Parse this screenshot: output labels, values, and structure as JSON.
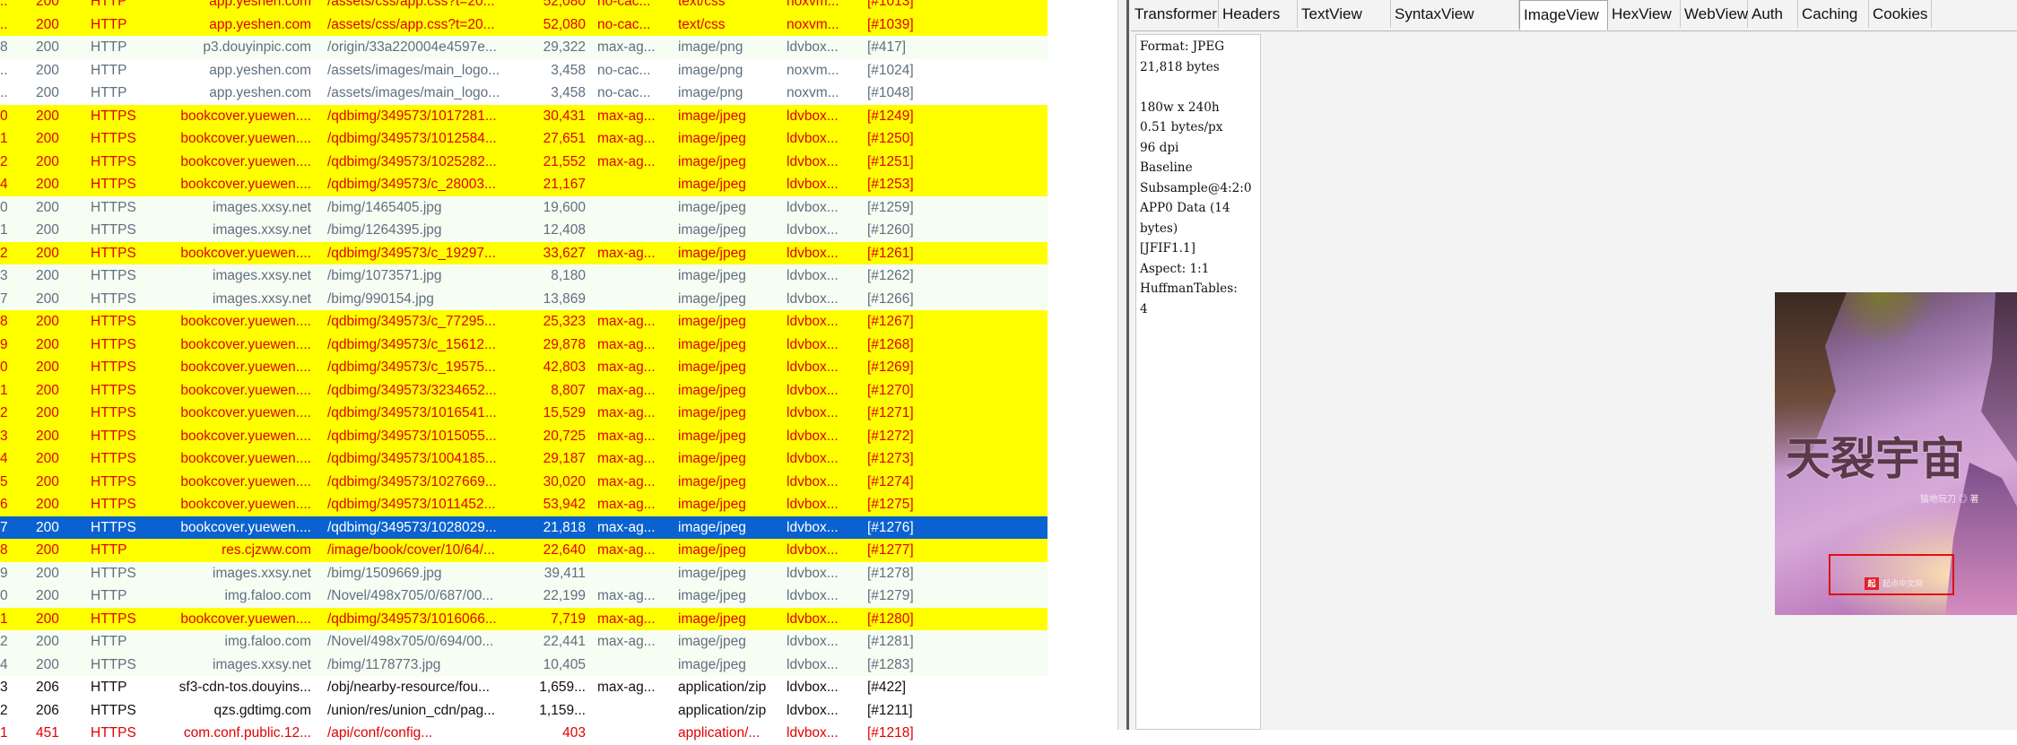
{
  "colors": {
    "highlight_yellow": "#ffff00",
    "selected_blue": "#0a62d0",
    "row_green": "#f6fdf3",
    "red_text": "#e00000"
  },
  "grid": {
    "rows": [
      {
        "id": "..",
        "result": "200",
        "protocol": "HTTP",
        "host": "app.yeshen.com",
        "url": "/assets/css/app.css?t=20...",
        "body": "52,080",
        "caching": "no-cac...",
        "content_type": "text/css",
        "process": "noxvm...",
        "custom": "[#1013]",
        "style": "yellow red-text"
      },
      {
        "id": "..",
        "result": "200",
        "protocol": "HTTP",
        "host": "app.yeshen.com",
        "url": "/assets/css/app.css?t=20...",
        "body": "52,080",
        "caching": "no-cac...",
        "content_type": "text/css",
        "process": "noxvm...",
        "custom": "[#1039]",
        "style": "yellow red-text"
      },
      {
        "id": "8",
        "result": "200",
        "protocol": "HTTP",
        "host": "p3.douyinpic.com",
        "url": "/origin/33a220004e4597e...",
        "body": "29,322",
        "caching": "max-ag...",
        "content_type": "image/png",
        "process": "ldvbox...",
        "custom": "[#417]",
        "style": "gray-text"
      },
      {
        "id": "..",
        "result": "200",
        "protocol": "HTTP",
        "host": "app.yeshen.com",
        "url": "/assets/images/main_logo...",
        "body": "3,458",
        "caching": "no-cac...",
        "content_type": "image/png",
        "process": "noxvm...",
        "custom": "[#1024]",
        "style": "white gray-text"
      },
      {
        "id": "..",
        "result": "200",
        "protocol": "HTTP",
        "host": "app.yeshen.com",
        "url": "/assets/images/main_logo...",
        "body": "3,458",
        "caching": "no-cac...",
        "content_type": "image/png",
        "process": "noxvm...",
        "custom": "[#1048]",
        "style": "white gray-text"
      },
      {
        "id": "0",
        "result": "200",
        "protocol": "HTTPS",
        "host": "bookcover.yuewen....",
        "url": "/qdbimg/349573/1017281...",
        "body": "30,431",
        "caching": "max-ag...",
        "content_type": "image/jpeg",
        "process": "ldvbox...",
        "custom": "[#1249]",
        "style": "yellow red-text"
      },
      {
        "id": "1",
        "result": "200",
        "protocol": "HTTPS",
        "host": "bookcover.yuewen....",
        "url": "/qdbimg/349573/1012584...",
        "body": "27,651",
        "caching": "max-ag...",
        "content_type": "image/jpeg",
        "process": "ldvbox...",
        "custom": "[#1250]",
        "style": "yellow red-text"
      },
      {
        "id": "2",
        "result": "200",
        "protocol": "HTTPS",
        "host": "bookcover.yuewen....",
        "url": "/qdbimg/349573/1025282...",
        "body": "21,552",
        "caching": "max-ag...",
        "content_type": "image/jpeg",
        "process": "ldvbox...",
        "custom": "[#1251]",
        "style": "yellow red-text"
      },
      {
        "id": "4",
        "result": "200",
        "protocol": "HTTPS",
        "host": "bookcover.yuewen....",
        "url": "/qdbimg/349573/c_28003...",
        "body": "21,167",
        "caching": "",
        "content_type": "image/jpeg",
        "process": "ldvbox...",
        "custom": "[#1253]",
        "style": "yellow red-text"
      },
      {
        "id": "0",
        "result": "200",
        "protocol": "HTTPS",
        "host": "images.xxsy.net",
        "url": "/bimg/1465405.jpg",
        "body": "19,600",
        "caching": "",
        "content_type": "image/jpeg",
        "process": "ldvbox...",
        "custom": "[#1259]",
        "style": "gray-text"
      },
      {
        "id": "1",
        "result": "200",
        "protocol": "HTTPS",
        "host": "images.xxsy.net",
        "url": "/bimg/1264395.jpg",
        "body": "12,408",
        "caching": "",
        "content_type": "image/jpeg",
        "process": "ldvbox...",
        "custom": "[#1260]",
        "style": "gray-text"
      },
      {
        "id": "2",
        "result": "200",
        "protocol": "HTTPS",
        "host": "bookcover.yuewen....",
        "url": "/qdbimg/349573/c_19297...",
        "body": "33,627",
        "caching": "max-ag...",
        "content_type": "image/jpeg",
        "process": "ldvbox...",
        "custom": "[#1261]",
        "style": "yellow red-text"
      },
      {
        "id": "3",
        "result": "200",
        "protocol": "HTTPS",
        "host": "images.xxsy.net",
        "url": "/bimg/1073571.jpg",
        "body": "8,180",
        "caching": "",
        "content_type": "image/jpeg",
        "process": "ldvbox...",
        "custom": "[#1262]",
        "style": "gray-text"
      },
      {
        "id": "7",
        "result": "200",
        "protocol": "HTTPS",
        "host": "images.xxsy.net",
        "url": "/bimg/990154.jpg",
        "body": "13,869",
        "caching": "",
        "content_type": "image/jpeg",
        "process": "ldvbox...",
        "custom": "[#1266]",
        "style": "gray-text"
      },
      {
        "id": "8",
        "result": "200",
        "protocol": "HTTPS",
        "host": "bookcover.yuewen....",
        "url": "/qdbimg/349573/c_77295...",
        "body": "25,323",
        "caching": "max-ag...",
        "content_type": "image/jpeg",
        "process": "ldvbox...",
        "custom": "[#1267]",
        "style": "yellow red-text"
      },
      {
        "id": "9",
        "result": "200",
        "protocol": "HTTPS",
        "host": "bookcover.yuewen....",
        "url": "/qdbimg/349573/c_15612...",
        "body": "29,878",
        "caching": "max-ag...",
        "content_type": "image/jpeg",
        "process": "ldvbox...",
        "custom": "[#1268]",
        "style": "yellow red-text"
      },
      {
        "id": "0",
        "result": "200",
        "protocol": "HTTPS",
        "host": "bookcover.yuewen....",
        "url": "/qdbimg/349573/c_19575...",
        "body": "42,803",
        "caching": "max-ag...",
        "content_type": "image/jpeg",
        "process": "ldvbox...",
        "custom": "[#1269]",
        "style": "yellow red-text"
      },
      {
        "id": "1",
        "result": "200",
        "protocol": "HTTPS",
        "host": "bookcover.yuewen....",
        "url": "/qdbimg/349573/3234652...",
        "body": "8,807",
        "caching": "max-ag...",
        "content_type": "image/jpeg",
        "process": "ldvbox...",
        "custom": "[#1270]",
        "style": "yellow red-text"
      },
      {
        "id": "2",
        "result": "200",
        "protocol": "HTTPS",
        "host": "bookcover.yuewen....",
        "url": "/qdbimg/349573/1016541...",
        "body": "15,529",
        "caching": "max-ag...",
        "content_type": "image/jpeg",
        "process": "ldvbox...",
        "custom": "[#1271]",
        "style": "yellow red-text"
      },
      {
        "id": "3",
        "result": "200",
        "protocol": "HTTPS",
        "host": "bookcover.yuewen....",
        "url": "/qdbimg/349573/1015055...",
        "body": "20,725",
        "caching": "max-ag...",
        "content_type": "image/jpeg",
        "process": "ldvbox...",
        "custom": "[#1272]",
        "style": "yellow red-text"
      },
      {
        "id": "4",
        "result": "200",
        "protocol": "HTTPS",
        "host": "bookcover.yuewen....",
        "url": "/qdbimg/349573/1004185...",
        "body": "29,187",
        "caching": "max-ag...",
        "content_type": "image/jpeg",
        "process": "ldvbox...",
        "custom": "[#1273]",
        "style": "yellow red-text"
      },
      {
        "id": "5",
        "result": "200",
        "protocol": "HTTPS",
        "host": "bookcover.yuewen....",
        "url": "/qdbimg/349573/1027669...",
        "body": "30,020",
        "caching": "max-ag...",
        "content_type": "image/jpeg",
        "process": "ldvbox...",
        "custom": "[#1274]",
        "style": "yellow red-text"
      },
      {
        "id": "6",
        "result": "200",
        "protocol": "HTTPS",
        "host": "bookcover.yuewen....",
        "url": "/qdbimg/349573/1011452...",
        "body": "53,942",
        "caching": "max-ag...",
        "content_type": "image/jpeg",
        "process": "ldvbox...",
        "custom": "[#1275]",
        "style": "yellow red-text"
      },
      {
        "id": "7",
        "result": "200",
        "protocol": "HTTPS",
        "host": "bookcover.yuewen....",
        "url": "/qdbimg/349573/1028029...",
        "body": "21,818",
        "caching": "max-ag...",
        "content_type": "image/jpeg",
        "process": "ldvbox...",
        "custom": "[#1276]",
        "style": "selected"
      },
      {
        "id": "8",
        "result": "200",
        "protocol": "HTTP",
        "host": "res.cjzww.com",
        "url": "/image/book/cover/10/64/...",
        "body": "22,640",
        "caching": "max-ag...",
        "content_type": "image/jpeg",
        "process": "ldvbox...",
        "custom": "[#1277]",
        "style": "yellow red-text"
      },
      {
        "id": "9",
        "result": "200",
        "protocol": "HTTPS",
        "host": "images.xxsy.net",
        "url": "/bimg/1509669.jpg",
        "body": "39,411",
        "caching": "",
        "content_type": "image/jpeg",
        "process": "ldvbox...",
        "custom": "[#1278]",
        "style": "gray-text"
      },
      {
        "id": "0",
        "result": "200",
        "protocol": "HTTP",
        "host": "img.faloo.com",
        "url": "/Novel/498x705/0/687/00...",
        "body": "22,199",
        "caching": "max-ag...",
        "content_type": "image/jpeg",
        "process": "ldvbox...",
        "custom": "[#1279]",
        "style": "gray-text"
      },
      {
        "id": "1",
        "result": "200",
        "protocol": "HTTPS",
        "host": "bookcover.yuewen....",
        "url": "/qdbimg/349573/1016066...",
        "body": "7,719",
        "caching": "max-ag...",
        "content_type": "image/jpeg",
        "process": "ldvbox...",
        "custom": "[#1280]",
        "style": "yellow red-text"
      },
      {
        "id": "2",
        "result": "200",
        "protocol": "HTTP",
        "host": "img.faloo.com",
        "url": "/Novel/498x705/0/694/00...",
        "body": "22,441",
        "caching": "max-ag...",
        "content_type": "image/jpeg",
        "process": "ldvbox...",
        "custom": "[#1281]",
        "style": "gray-text"
      },
      {
        "id": "4",
        "result": "200",
        "protocol": "HTTPS",
        "host": "images.xxsy.net",
        "url": "/bimg/1178773.jpg",
        "body": "10,405",
        "caching": "",
        "content_type": "image/jpeg",
        "process": "ldvbox...",
        "custom": "[#1283]",
        "style": "gray-text"
      },
      {
        "id": "3",
        "result": "206",
        "protocol": "HTTP",
        "host": "sf3-cdn-tos.douyins...",
        "url": "/obj/nearby-resource/fou...",
        "body": "1,659...",
        "caching": "max-ag...",
        "content_type": "application/zip",
        "process": "ldvbox...",
        "custom": "[#422]",
        "style": "white black-text"
      },
      {
        "id": "2",
        "result": "206",
        "protocol": "HTTPS",
        "host": "qzs.gdtimg.com",
        "url": "/union/res/union_cdn/pag...",
        "body": "1,159...",
        "caching": "",
        "content_type": "application/zip",
        "process": "ldvbox...",
        "custom": "[#1211]",
        "style": "white black-text"
      },
      {
        "id": "1",
        "result": "451",
        "protocol": "HTTPS",
        "host": "com.conf.public.12...",
        "url": "/api/conf/config...",
        "body": "403",
        "caching": "",
        "content_type": "application/...",
        "process": "ldvbox...",
        "custom": "[#1218]",
        "style": "white red-text"
      }
    ]
  },
  "inspector": {
    "tabs": [
      "Transformer",
      "Headers",
      "TextView",
      "SyntaxView",
      "ImageView",
      "HexView",
      "WebView",
      "Auth",
      "Caching",
      "Cookies"
    ],
    "active_tab": "ImageView",
    "meta_lines": [
      "Format: JPEG",
      "21,818 bytes",
      "",
      "180w x 240h",
      "0.51 bytes/px",
      "96 dpi",
      "Baseline",
      "Subsample@4:2:0",
      "APP0 Data (14",
      "bytes)",
      "[JFIF1.1]",
      "Aspect: 1:1",
      "HuffmanTables:",
      "4"
    ],
    "cover": {
      "title": "天裂宇宙",
      "author": "猫地玩刀 ◎ 著",
      "logo": "起点中文网"
    }
  }
}
